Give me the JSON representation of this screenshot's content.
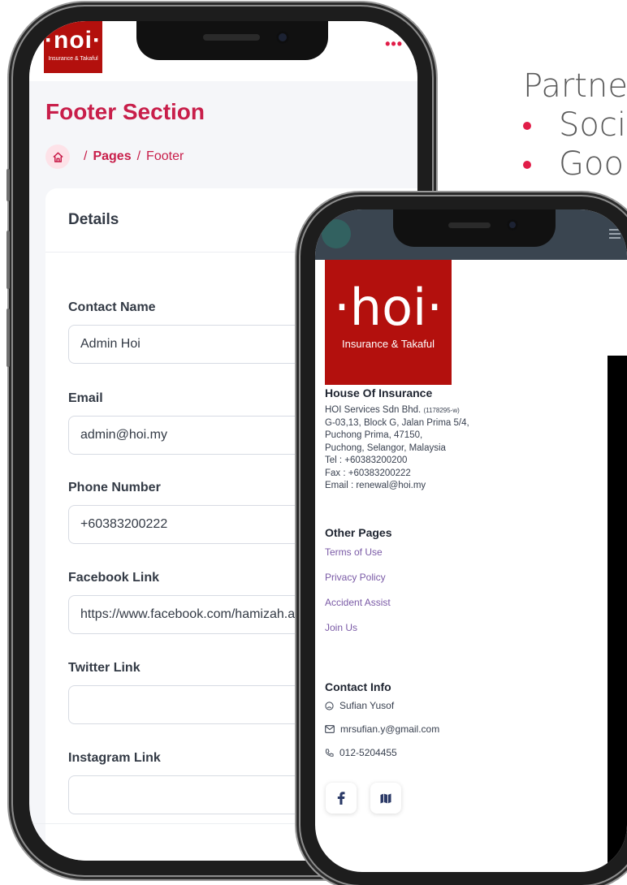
{
  "slide": {
    "heading": "Partne",
    "bullets": [
      "Soci",
      "Goo"
    ]
  },
  "admin": {
    "logo_text": "·noi·",
    "logo_sub": "Insurance & Takaful",
    "menu_icon": "more-dots-icon",
    "title": "Footer Section",
    "breadcrumb": {
      "home_icon": "home-icon",
      "pages": "Pages",
      "current": "Footer",
      "separator": "/"
    },
    "card_title": "Details",
    "fields": [
      {
        "label": "Contact Name",
        "value": "Admin Hoi",
        "placeholder": ""
      },
      {
        "label": "Email",
        "value": "admin@hoi.my",
        "placeholder": ""
      },
      {
        "label": "Phone Number",
        "value": "+60383200222",
        "placeholder": ""
      },
      {
        "label": "Facebook Link",
        "value": "https://www.facebook.com/hamizah.a",
        "placeholder": ""
      },
      {
        "label": "Twitter Link",
        "value": "",
        "placeholder": ""
      },
      {
        "label": "Instagram Link",
        "value": "",
        "placeholder": ""
      }
    ]
  },
  "site": {
    "logo_text": "·hoi·",
    "logo_sub": "Insurance & Takaful",
    "company_title": "House Of Insurance",
    "company_name": "HOI Services Sdn Bhd.",
    "company_reg": "(1178295-w)",
    "address": [
      "G-03,13, Block G, Jalan Prima 5/4,",
      "Puchong Prima, 47150,",
      "Puchong, Selangor, Malaysia"
    ],
    "tel": "Tel : +60383200200",
    "fax": "Fax : +60383200222",
    "email": "Email : renewal@hoi.my",
    "other_pages_title": "Other Pages",
    "other_pages": [
      "Terms of Use",
      "Privacy Policy",
      "Accident Assist",
      "Join Us"
    ],
    "contact_title": "Contact Info",
    "contact": {
      "name": "Sufian Yusof",
      "email": "mrsufian.y@gmail.com",
      "phone": "012-5204455"
    },
    "social": [
      {
        "icon": "facebook-icon"
      },
      {
        "icon": "map-icon"
      }
    ]
  },
  "colors": {
    "brand_red": "#b3100d",
    "accent": "#c81e4a",
    "link_purple": "#7a5aa6"
  }
}
